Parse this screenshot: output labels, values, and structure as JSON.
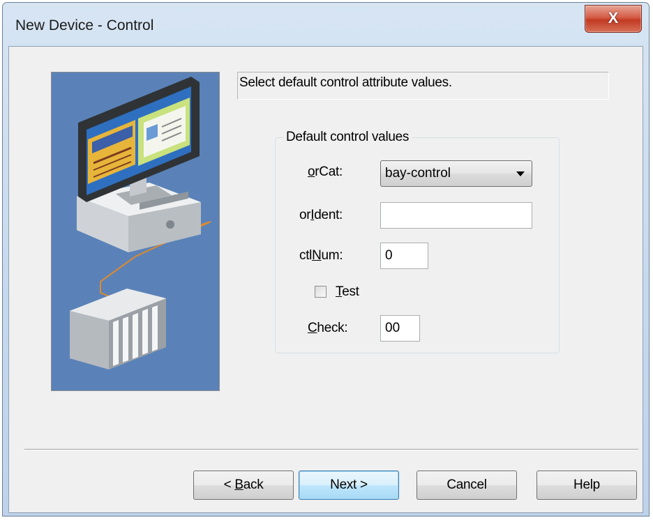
{
  "window": {
    "title": "New Device - Control",
    "close_label": "X"
  },
  "description": "Select default control attribute values.",
  "group": {
    "title": "Default control values",
    "fields": {
      "orcat": {
        "label_pre": "",
        "label_mn": "o",
        "label_post": "rCat:",
        "value": "bay-control"
      },
      "orident": {
        "label_pre": "or",
        "label_mn": "I",
        "label_post": "dent:",
        "value": ""
      },
      "ctlnum": {
        "label_pre": "ctl",
        "label_mn": "N",
        "label_post": "um:",
        "value": "0"
      },
      "test": {
        "label_pre": "",
        "label_mn": "T",
        "label_post": "est",
        "checked": false
      },
      "check": {
        "label_pre": "",
        "label_mn": "C",
        "label_post": "heck:",
        "value": "00"
      }
    }
  },
  "buttons": {
    "back": {
      "pre": "< ",
      "mn": "B",
      "post": "ack"
    },
    "next": "Next >",
    "cancel": "Cancel",
    "help": "Help"
  },
  "colors": {
    "art_background": "#5a82b8",
    "title_bar": "#c4d8ee",
    "close_button": "#c23a22",
    "client_background": "#f0f0f0"
  }
}
